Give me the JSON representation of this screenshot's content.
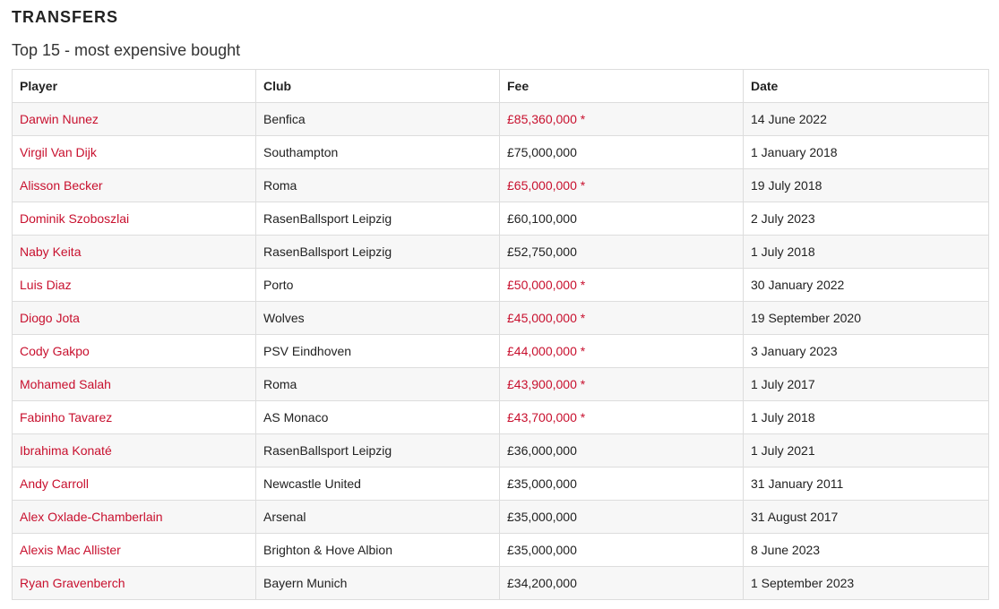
{
  "page": {
    "section_title": "TRANSFERS",
    "subtitle": "Top 15 - most expensive bought"
  },
  "colors": {
    "accent": "#c8102e",
    "text": "#222222",
    "row_stripe": "#f7f7f7",
    "border": "#dddddd"
  },
  "table": {
    "headers": {
      "player": "Player",
      "club": "Club",
      "fee": "Fee",
      "date": "Date"
    },
    "rows": [
      {
        "player": "Darwin Nunez",
        "club": "Benfica",
        "fee": "£85,360,000 *",
        "fee_highlight": true,
        "date": "14 June 2022"
      },
      {
        "player": "Virgil Van Dijk",
        "club": "Southampton",
        "fee": "£75,000,000",
        "fee_highlight": false,
        "date": "1 January 2018"
      },
      {
        "player": "Alisson Becker",
        "club": "Roma",
        "fee": "£65,000,000 *",
        "fee_highlight": true,
        "date": "19 July 2018"
      },
      {
        "player": "Dominik Szoboszlai",
        "club": "RasenBallsport Leipzig",
        "fee": "£60,100,000",
        "fee_highlight": false,
        "date": "2 July 2023"
      },
      {
        "player": "Naby Keita",
        "club": "RasenBallsport Leipzig",
        "fee": "£52,750,000",
        "fee_highlight": false,
        "date": "1 July 2018"
      },
      {
        "player": "Luis Diaz",
        "club": "Porto",
        "fee": "£50,000,000 *",
        "fee_highlight": true,
        "date": "30 January 2022"
      },
      {
        "player": "Diogo Jota",
        "club": "Wolves",
        "fee": "£45,000,000 *",
        "fee_highlight": true,
        "date": "19 September 2020"
      },
      {
        "player": "Cody Gakpo",
        "club": "PSV Eindhoven",
        "fee": "£44,000,000 *",
        "fee_highlight": true,
        "date": "3 January 2023"
      },
      {
        "player": "Mohamed Salah",
        "club": "Roma",
        "fee": "£43,900,000 *",
        "fee_highlight": true,
        "date": "1 July 2017"
      },
      {
        "player": "Fabinho Tavarez",
        "club": "AS Monaco",
        "fee": "£43,700,000 *",
        "fee_highlight": true,
        "date": "1 July 2018"
      },
      {
        "player": "Ibrahima Konaté",
        "club": "RasenBallsport Leipzig",
        "fee": "£36,000,000",
        "fee_highlight": false,
        "date": "1 July 2021"
      },
      {
        "player": "Andy Carroll",
        "club": "Newcastle United",
        "fee": "£35,000,000",
        "fee_highlight": false,
        "date": "31 January 2011"
      },
      {
        "player": "Alex Oxlade-Chamberlain",
        "club": "Arsenal",
        "fee": "£35,000,000",
        "fee_highlight": false,
        "date": "31 August 2017"
      },
      {
        "player": "Alexis Mac Allister",
        "club": "Brighton & Hove Albion",
        "fee": "£35,000,000",
        "fee_highlight": false,
        "date": "8 June 2023"
      },
      {
        "player": "Ryan Gravenberch",
        "club": "Bayern Munich",
        "fee": "£34,200,000",
        "fee_highlight": false,
        "date": "1 September 2023"
      }
    ]
  }
}
